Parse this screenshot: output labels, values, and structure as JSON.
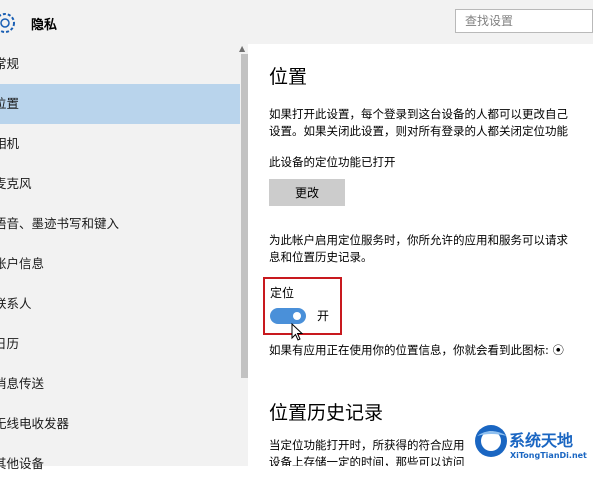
{
  "header": {
    "title": "隐私",
    "search_placeholder": "查找设置"
  },
  "sidebar": {
    "items": [
      {
        "label": "常规"
      },
      {
        "label": "位置",
        "selected": true
      },
      {
        "label": "相机"
      },
      {
        "label": "麦克风"
      },
      {
        "label": "语音、墨迹书写和键入"
      },
      {
        "label": "帐户信息"
      },
      {
        "label": "联系人"
      },
      {
        "label": "日历"
      },
      {
        "label": "消息传送"
      },
      {
        "label": "无线电收发器"
      },
      {
        "label": "其他设备"
      }
    ]
  },
  "main": {
    "title": "位置",
    "intro_line1": "如果打开此设置，每个登录到这台设备的人都可以更改自己",
    "intro_line2": "设置。如果关闭此设置，则对所有登录的人都关闭定位功能",
    "device_status": "此设备的定位功能已打开",
    "change_button": "更改",
    "account_line1": "为此帐户启用定位服务时，你所允许的应用和服务可以请求",
    "account_line2": "息和位置历史记录。",
    "location_label": "定位",
    "toggle_state": "开",
    "toggle_on": true,
    "icon_note": "如果有应用正在使用你的位置信息，你就会看到此图标: ⦿",
    "history_title": "位置历史记录",
    "history_line1": "当定位功能打开时，所获得的符合应用",
    "history_line2": "设备上存储一定的时间，那些可以访问"
  },
  "watermark": {
    "name": "系统天地",
    "url": "XiTongTianDi.net"
  },
  "colors": {
    "toggle_blue": "#4a90d9",
    "selected_bg": "#b9d4ec",
    "highlight_red": "#c8191e"
  }
}
